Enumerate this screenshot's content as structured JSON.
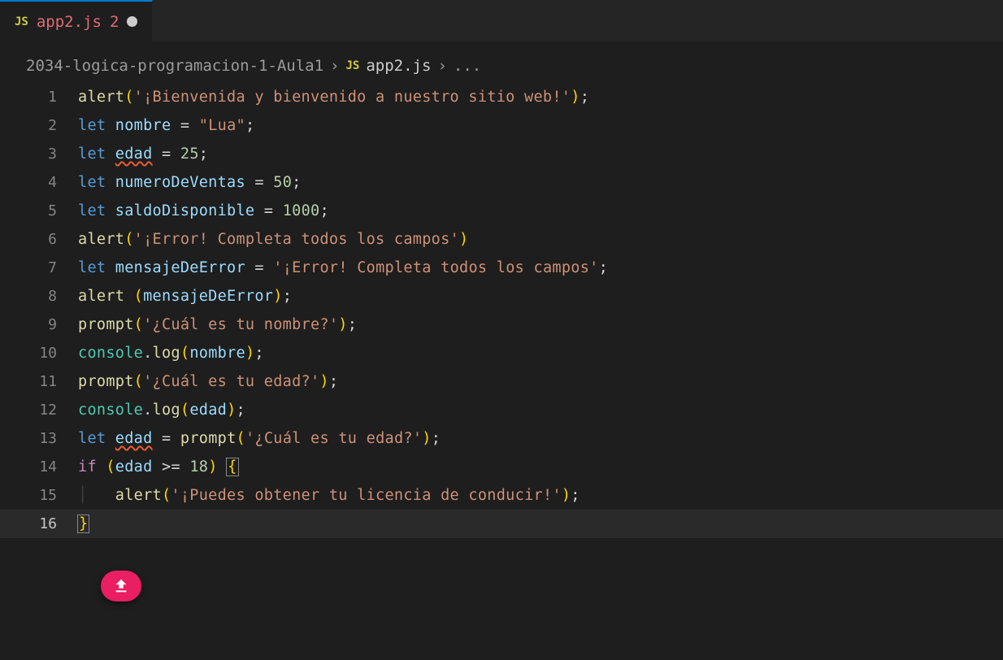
{
  "tab": {
    "icon_label": "JS",
    "filename": "app2.js",
    "problems_count": "2"
  },
  "breadcrumb": {
    "folder": "2034-logica-programacion-1-Aula1",
    "sep": "›",
    "icon_label": "JS",
    "file": "app2.js",
    "tail": "..."
  },
  "code": {
    "fn_alert": "alert",
    "fn_prompt": "prompt",
    "fn_log": "log",
    "obj_console": "console",
    "kw_let": "let",
    "kw_if": "if",
    "op_assign": " = ",
    "op_gte": " >= ",
    "semi": ";",
    "lparen": "(",
    "rparen": ")",
    "lbrace": "{",
    "rbrace": "}",
    "dot": ".",
    "space": " ",
    "var_nombre": "nombre",
    "var_edad": "edad",
    "var_numeroDeVentas": "numeroDeVentas",
    "var_saldoDisponible": "saldoDisponible",
    "var_mensajeDeError": "mensajeDeError",
    "str_bienvenida": "'¡Bienvenida y bienvenido a nuestro sitio web!'",
    "str_lua": "\"Lua\"",
    "num_25": "25",
    "num_50": "50",
    "num_1000": "1000",
    "num_18": "18",
    "str_error": "'¡Error! Completa todos los campos'",
    "str_cual_nombre": "'¿Cuál es tu nombre?'",
    "str_cual_edad": "'¿Cuál es tu edad?'",
    "str_licencia": "'¡Puedes obtener tu licencia de conducir!'",
    "ln": {
      "1": "1",
      "2": "2",
      "3": "3",
      "4": "4",
      "5": "5",
      "6": "6",
      "7": "7",
      "8": "8",
      "9": "9",
      "10": "10",
      "11": "11",
      "12": "12",
      "13": "13",
      "14": "14",
      "15": "15",
      "16": "16"
    }
  }
}
